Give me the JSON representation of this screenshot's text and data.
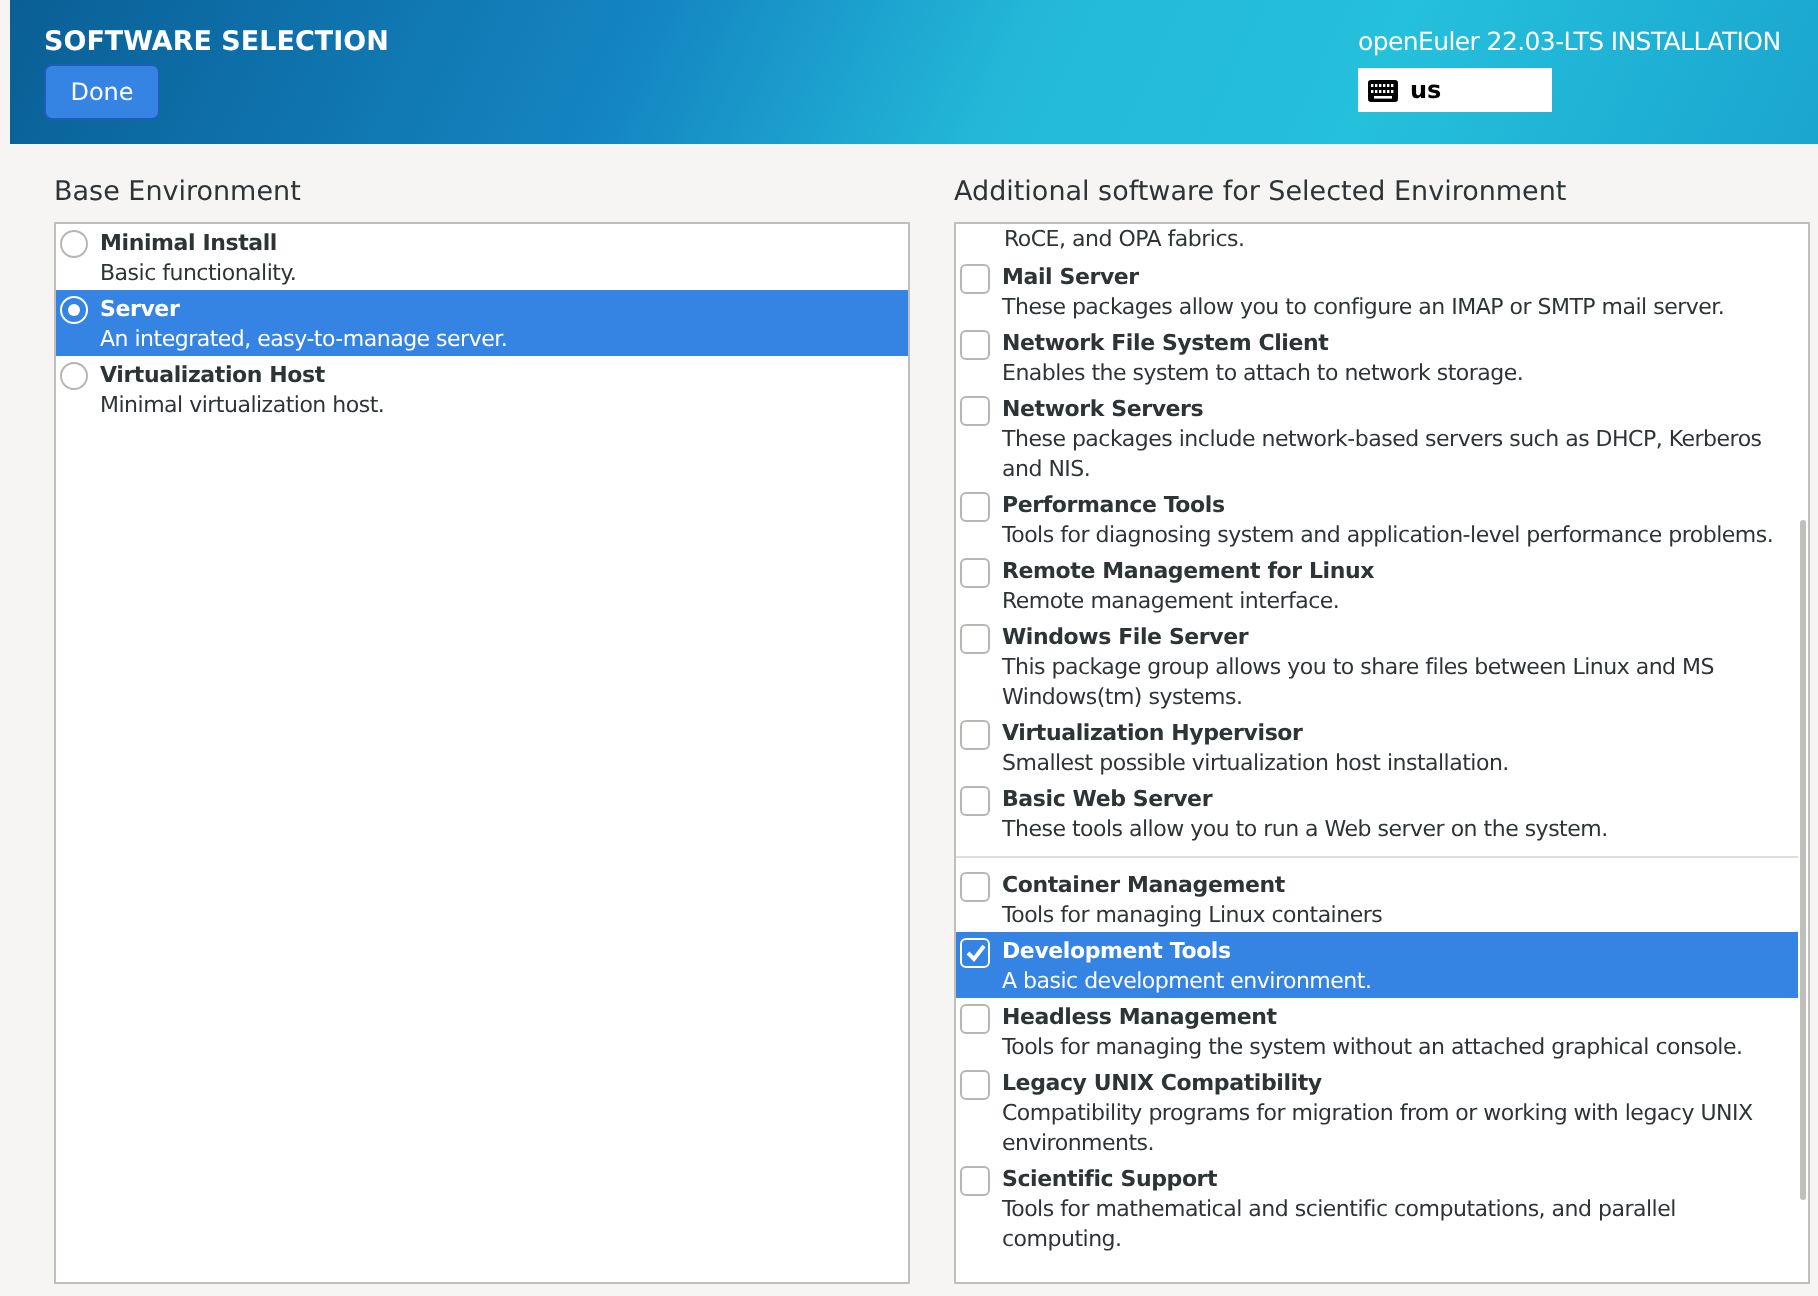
{
  "header": {
    "title": "SOFTWARE SELECTION",
    "done_button": "Done",
    "product": "openEuler 22.03-LTS INSTALLATION",
    "keyboard_layout": "us"
  },
  "base_environment": {
    "heading": "Base Environment",
    "items": [
      {
        "name": "Minimal Install",
        "description": "Basic functionality.",
        "selected": false
      },
      {
        "name": "Server",
        "description": "An integrated, easy-to-manage server.",
        "selected": true
      },
      {
        "name": "Virtualization Host",
        "description": "Minimal virtualization host.",
        "selected": false
      }
    ]
  },
  "additional_software": {
    "heading": "Additional software for Selected Environment",
    "items": [
      {
        "kind": "fragment",
        "description": "RoCE, and OPA fabrics."
      },
      {
        "kind": "option",
        "name": "Mail Server",
        "description": "These packages allow you to configure an IMAP or SMTP mail server.",
        "checked": false,
        "selected": false
      },
      {
        "kind": "option",
        "name": "Network File System Client",
        "description": "Enables the system to attach to network storage.",
        "checked": false,
        "selected": false
      },
      {
        "kind": "option",
        "name": "Network Servers",
        "description": "These packages include network-based servers such as DHCP, Kerberos and NIS.",
        "checked": false,
        "selected": false
      },
      {
        "kind": "option",
        "name": "Performance Tools",
        "description": "Tools for diagnosing system and application-level performance problems.",
        "checked": false,
        "selected": false
      },
      {
        "kind": "option",
        "name": "Remote Management for Linux",
        "description": "Remote management interface.",
        "checked": false,
        "selected": false
      },
      {
        "kind": "option",
        "name": "Windows File Server",
        "description": "This package group allows you to share files between Linux and MS Windows(tm) systems.",
        "checked": false,
        "selected": false
      },
      {
        "kind": "option",
        "name": "Virtualization Hypervisor",
        "description": "Smallest possible virtualization host installation.",
        "checked": false,
        "selected": false
      },
      {
        "kind": "option",
        "name": "Basic Web Server",
        "description": "These tools allow you to run a Web server on the system.",
        "checked": false,
        "selected": false
      },
      {
        "kind": "separator"
      },
      {
        "kind": "option",
        "name": "Container Management",
        "description": "Tools for managing Linux containers",
        "checked": false,
        "selected": false
      },
      {
        "kind": "option",
        "name": "Development Tools",
        "description": "A basic development environment.",
        "checked": true,
        "selected": true
      },
      {
        "kind": "option",
        "name": "Headless Management",
        "description": "Tools for managing the system without an attached graphical console.",
        "checked": false,
        "selected": false
      },
      {
        "kind": "option",
        "name": "Legacy UNIX Compatibility",
        "description": "Compatibility programs for migration from or working with legacy UNIX environments.",
        "checked": false,
        "selected": false
      },
      {
        "kind": "option",
        "name": "Scientific Support",
        "description": "Tools for mathematical and scientific computations, and parallel computing.",
        "checked": false,
        "selected": false
      }
    ]
  }
}
